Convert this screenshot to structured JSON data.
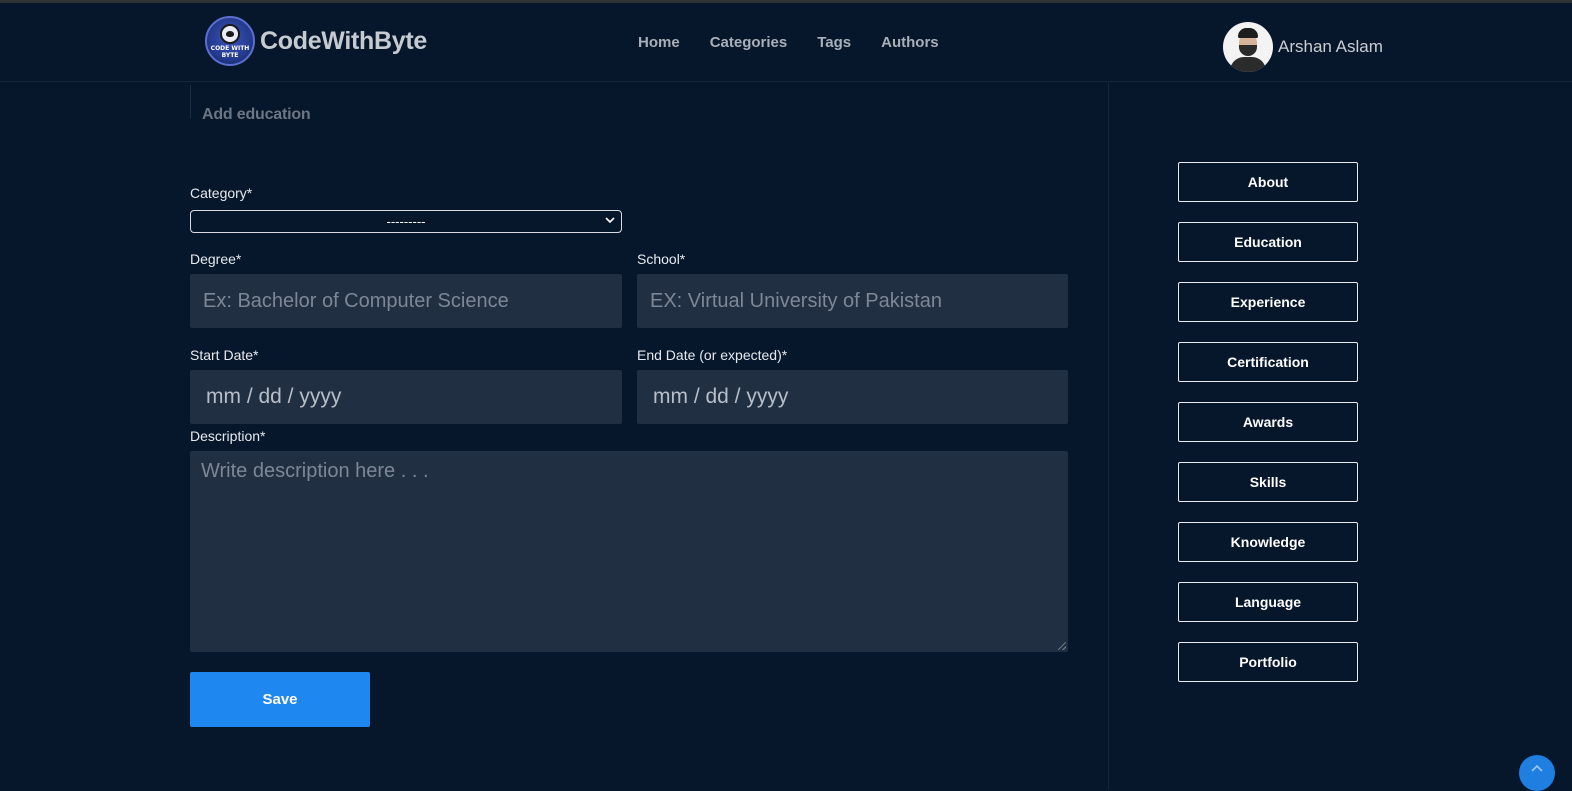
{
  "brand": {
    "name": "CodeWithByte",
    "logo_text": "CODE WITH BYTE"
  },
  "nav": {
    "items": [
      {
        "label": "Home"
      },
      {
        "label": "Categories"
      },
      {
        "label": "Tags"
      },
      {
        "label": "Authors"
      }
    ]
  },
  "user": {
    "name": "Arshan Aslam"
  },
  "form": {
    "title": "Add education",
    "category_label": "Category*",
    "category_value": "---------",
    "degree_label": "Degree*",
    "degree_placeholder": "Ex: Bachelor of Computer Science",
    "school_label": "School*",
    "school_placeholder": "EX: Virtual University of Pakistan",
    "start_date_label": "Start Date*",
    "start_date_placeholder": "mm / dd / yyyy",
    "end_date_label": "End Date (or expected)*",
    "end_date_placeholder": "mm / dd / yyyy",
    "description_label": "Description*",
    "description_placeholder": "Write description here . . .",
    "save_label": "Save"
  },
  "sidebar": {
    "items": [
      {
        "label": "About"
      },
      {
        "label": "Education"
      },
      {
        "label": "Experience"
      },
      {
        "label": "Certification"
      },
      {
        "label": "Awards"
      },
      {
        "label": "Skills"
      },
      {
        "label": "Knowledge"
      },
      {
        "label": "Language"
      },
      {
        "label": "Portfolio"
      }
    ]
  },
  "colors": {
    "background": "#07172b",
    "input_bg": "#202f42",
    "accent": "#1f87f0"
  },
  "icons": {
    "scroll_top": "chevron-up-icon",
    "select": "chevron-down-icon"
  }
}
